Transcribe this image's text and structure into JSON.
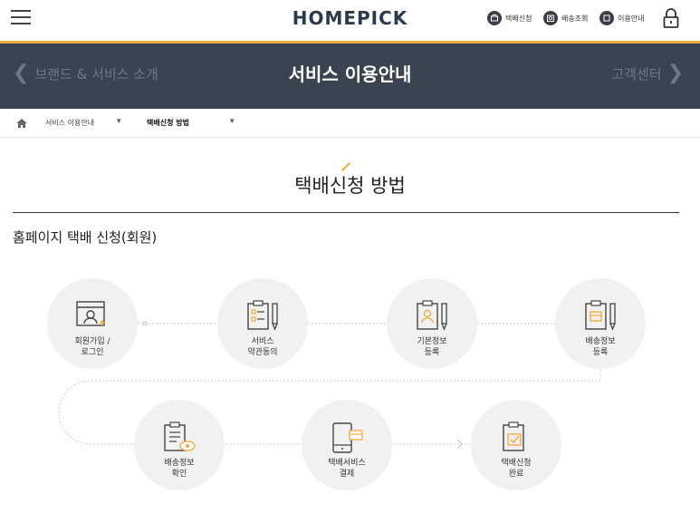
{
  "header": {
    "logo": "HOMEPICK",
    "util_links": [
      {
        "label": "택배신청",
        "icon": "parcel-icon"
      },
      {
        "label": "배송조회",
        "icon": "tracking-icon"
      },
      {
        "label": "이용안내",
        "icon": "guide-icon"
      }
    ],
    "accent_color": "#f2a93b"
  },
  "banner": {
    "title": "서비스 이용안내",
    "prev_label": "브랜드 & 서비스 소개",
    "next_label": "고객센터"
  },
  "breadcrumb": {
    "items": [
      "서비스 이용안내",
      "택배신청 방법"
    ]
  },
  "page": {
    "title": "택배신청 방법",
    "section_title": "홈페이지 택배 신청(회원)"
  },
  "steps": [
    {
      "line1": "회원가입 /",
      "line2": "로그인"
    },
    {
      "line1": "서비스",
      "line2": "약관동의"
    },
    {
      "line1": "기본정보",
      "line2": "등록"
    },
    {
      "line1": "배송정보",
      "line2": "등록"
    },
    {
      "line1": "배송정보",
      "line2": "확인"
    },
    {
      "line1": "택배서비스",
      "line2": "결제"
    },
    {
      "line1": "택배신청",
      "line2": "완료"
    }
  ]
}
